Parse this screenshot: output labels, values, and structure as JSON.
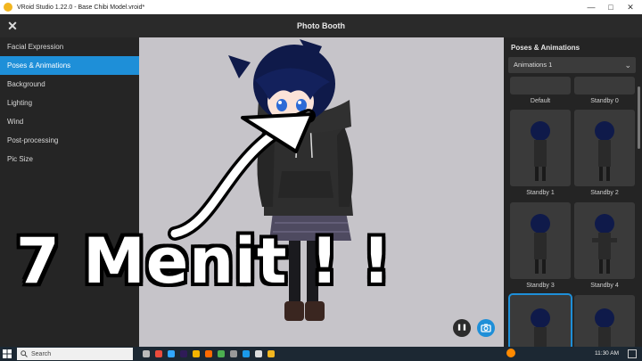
{
  "window": {
    "title": "VRoid Studio 1.22.0 - Base Chibi Model.vroid*"
  },
  "header": {
    "title": "Photo Booth"
  },
  "menu": [
    {
      "label": "Facial Expression",
      "active": false
    },
    {
      "label": "Poses & Animations",
      "active": true
    },
    {
      "label": "Background",
      "active": false
    },
    {
      "label": "Lighting",
      "active": false
    },
    {
      "label": "Wind",
      "active": false
    },
    {
      "label": "Post-processing",
      "active": false
    },
    {
      "label": "Pic Size",
      "active": false
    }
  ],
  "poses_panel": {
    "title": "Poses & Animations",
    "dropdown_value": "Animations 1",
    "items": [
      "Default",
      "Standby 0",
      "Standby 1",
      "Standby 2",
      "Standby 3",
      "Standby 4"
    ]
  },
  "overlay": {
    "text": "7 Menit ! !"
  },
  "taskbar": {
    "search_placeholder": "Search",
    "time": "11:30 AM"
  },
  "colors": {
    "accent": "#1e8fd8",
    "viewport_bg": "#c6c4c9",
    "panel_bg": "#252525"
  }
}
